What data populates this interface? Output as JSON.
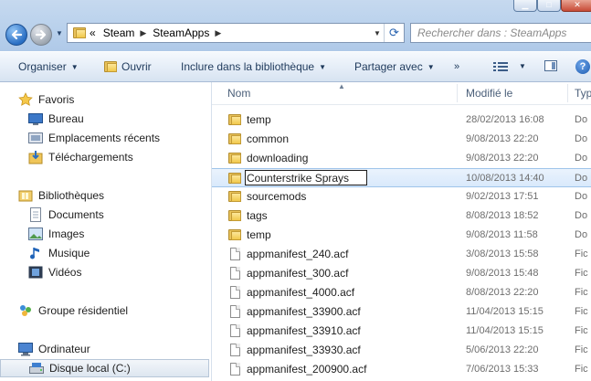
{
  "address": {
    "crumb_prefix": "«",
    "crumbs": [
      "Steam",
      "SteamApps"
    ],
    "search_placeholder": "Rechercher dans : SteamApps"
  },
  "commands": {
    "organise": "Organiser",
    "open": "Ouvrir",
    "include": "Inclure dans la bibliothèque",
    "share": "Partager avec",
    "more": "»",
    "help": "?"
  },
  "navigation": {
    "favorites": "Favoris",
    "desktop": "Bureau",
    "recent": "Emplacements récents",
    "downloads": "Téléchargements",
    "libraries": "Bibliothèques",
    "documents": "Documents",
    "images": "Images",
    "music": "Musique",
    "videos": "Vidéos",
    "homegroup": "Groupe résidentiel",
    "computer": "Ordinateur",
    "local_disk": "Disque local (C:)"
  },
  "columns": {
    "name": "Nom",
    "modified": "Modifié le",
    "type": "Typ"
  },
  "files": [
    {
      "name": "temp",
      "modified": "28/02/2013 16:08",
      "type": "Do",
      "kind": "folder"
    },
    {
      "name": "common",
      "modified": "9/08/2013 22:20",
      "type": "Do",
      "kind": "folder"
    },
    {
      "name": "downloading",
      "modified": "9/08/2013 22:20",
      "type": "Do",
      "kind": "folder"
    },
    {
      "name": "Counterstrike Sprays",
      "modified": "10/08/2013 14:40",
      "type": "Do",
      "kind": "folder",
      "editing": true
    },
    {
      "name": "sourcemods",
      "modified": "9/02/2013 17:51",
      "type": "Do",
      "kind": "folder"
    },
    {
      "name": "tags",
      "modified": "8/08/2013 18:52",
      "type": "Do",
      "kind": "folder"
    },
    {
      "name": "temp",
      "modified": "9/08/2013 11:58",
      "type": "Do",
      "kind": "folder"
    },
    {
      "name": "appmanifest_240.acf",
      "modified": "3/08/2013 15:58",
      "type": "Fic",
      "kind": "file"
    },
    {
      "name": "appmanifest_300.acf",
      "modified": "9/08/2013 15:48",
      "type": "Fic",
      "kind": "file"
    },
    {
      "name": "appmanifest_4000.acf",
      "modified": "8/08/2013 22:20",
      "type": "Fic",
      "kind": "file"
    },
    {
      "name": "appmanifest_33900.acf",
      "modified": "11/04/2013 15:15",
      "type": "Fic",
      "kind": "file"
    },
    {
      "name": "appmanifest_33910.acf",
      "modified": "11/04/2013 15:15",
      "type": "Fic",
      "kind": "file"
    },
    {
      "name": "appmanifest_33930.acf",
      "modified": "5/06/2013 22:20",
      "type": "Fic",
      "kind": "file"
    },
    {
      "name": "appmanifest_200900.acf",
      "modified": "7/06/2013 15:33",
      "type": "Fic",
      "kind": "file"
    }
  ]
}
